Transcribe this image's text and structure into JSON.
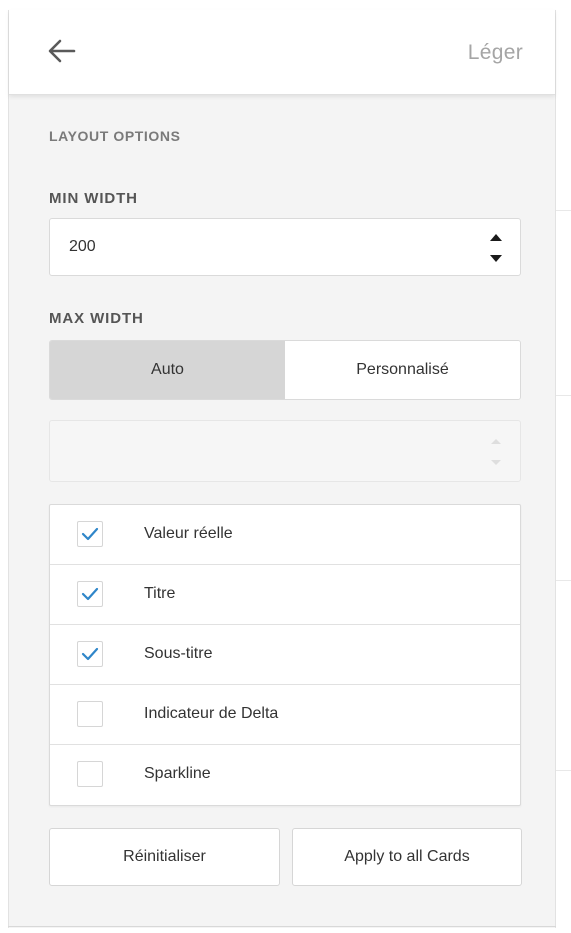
{
  "header": {
    "back_icon": "arrow-left-icon",
    "title": "Léger"
  },
  "layout_options": {
    "section_label": "LAYOUT OPTIONS",
    "min_width": {
      "label": "MIN WIDTH",
      "value": "200"
    },
    "max_width": {
      "label": "MAX WIDTH",
      "options": [
        "Auto",
        "Personnalisé"
      ],
      "selected": "Auto",
      "custom_value": ""
    }
  },
  "elements": [
    {
      "label": "Valeur réelle",
      "checked": true
    },
    {
      "label": "Titre",
      "checked": true
    },
    {
      "label": "Sous-titre",
      "checked": true
    },
    {
      "label": "Indicateur de Delta",
      "checked": false
    },
    {
      "label": "Sparkline",
      "checked": false
    }
  ],
  "actions": {
    "reset_label": "Réinitialiser",
    "apply_all_label": "Apply to all Cards"
  },
  "colors": {
    "accent": "#2f86c9",
    "active_toggle": "#d6d6d6",
    "panel_bg": "#f4f4f4"
  }
}
